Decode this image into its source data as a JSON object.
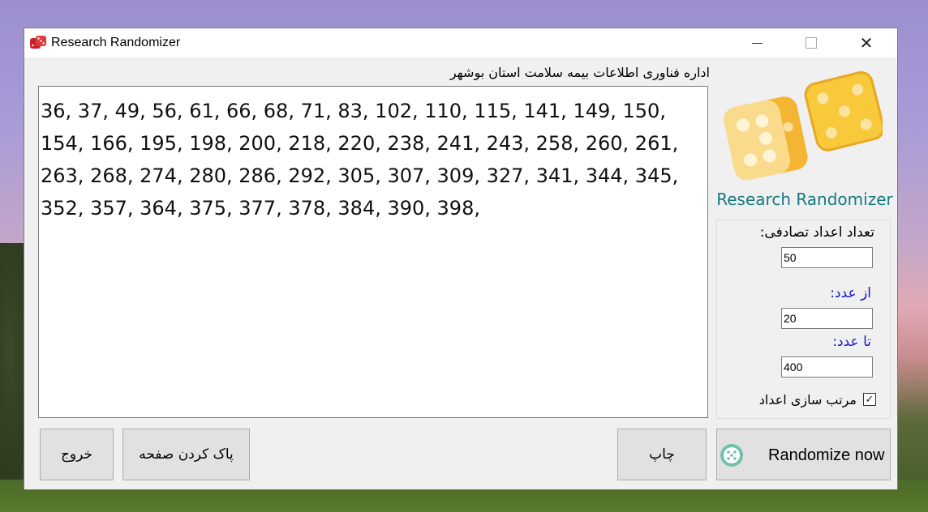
{
  "window": {
    "title": "Research Randomizer",
    "icon": "dice-icon",
    "controls": {
      "minimize": "minimize-icon",
      "maximize": "maximize-icon",
      "close": "close-icon"
    }
  },
  "header": {
    "organization": "اداره فناوری اطلاعات بیمه سلامت استان بوشهر"
  },
  "output": {
    "text": "36, 37, 49, 56, 61, 66, 68, 71, 83, 102, 110, 115, 141, 149, 150, 154, 166, 195, 198, 200, 218, 220, 238, 241, 243, 258, 260, 261, 263, 268, 274, 280, 286, 292, 305, 307, 309, 327, 341, 344, 345, 352, 357, 364, 375, 377, 378, 384, 390, 398,"
  },
  "brand": {
    "logo": "dice-logo-icon",
    "name": "Research Randomizer"
  },
  "settings": {
    "count_label": "تعداد اعداد تصادفی:",
    "count_value": "50",
    "from_label": "از عدد:",
    "from_value": "20",
    "to_label": "تا عدد:",
    "to_value": "400",
    "sort_label": "مرتب سازی اعداد",
    "sort_checked": true
  },
  "buttons": {
    "exit": "خروج",
    "clear": "پاک کردن صفحه",
    "print": "چاپ",
    "randomize": "Randomize now",
    "randomize_icon": "dice-icon"
  },
  "colors": {
    "brand_text": "#137a7f",
    "label_blue": "#1717c8",
    "dice_yellow": "#f5c84a"
  }
}
